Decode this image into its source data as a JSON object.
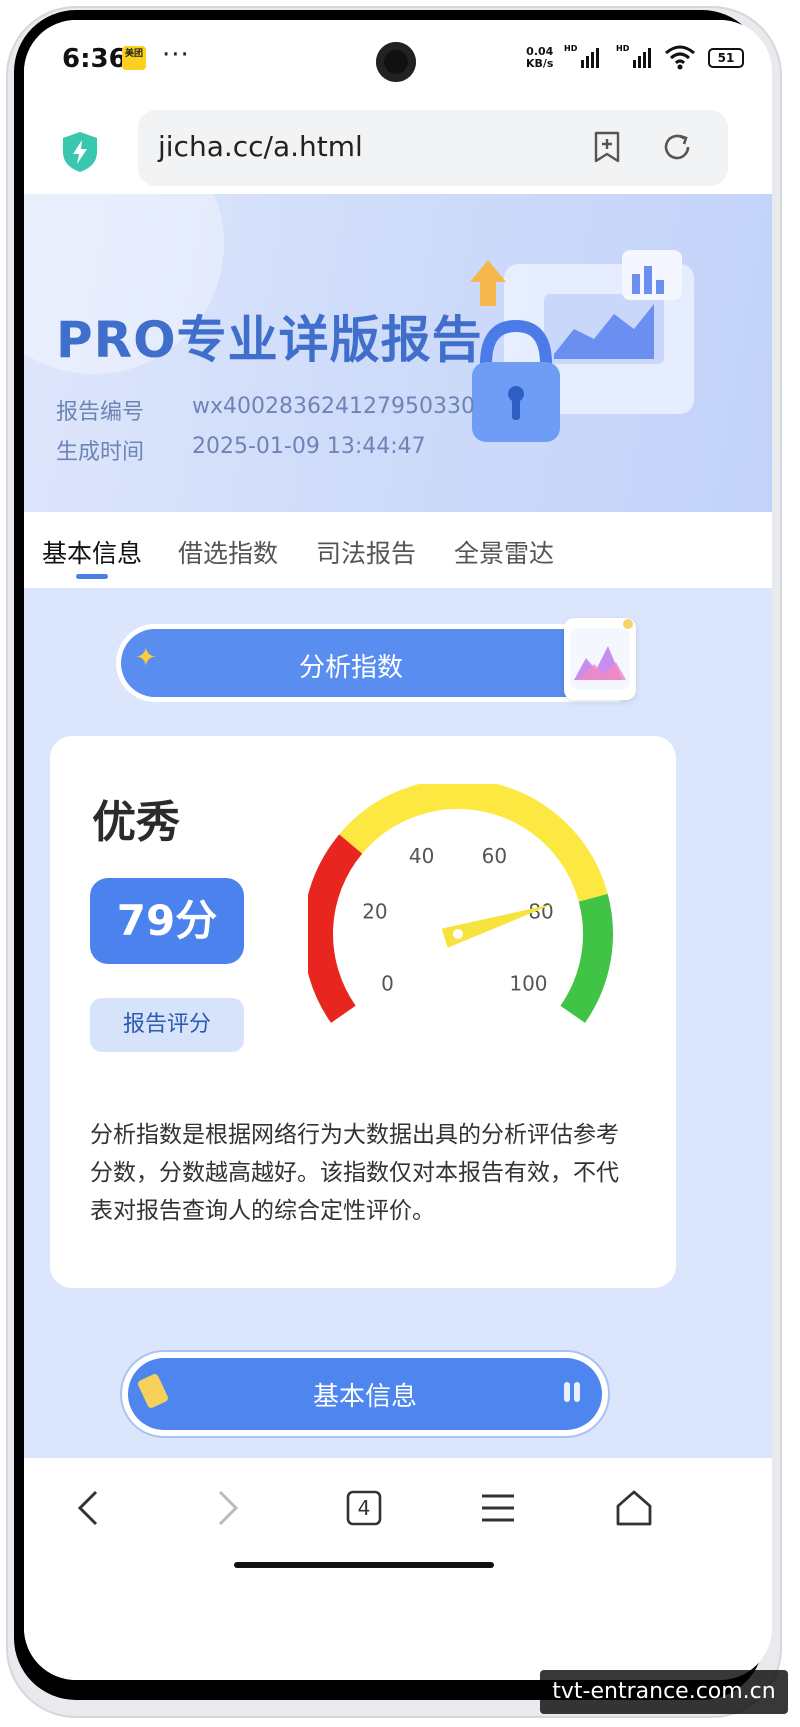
{
  "status_bar": {
    "time": "6:36",
    "app_badge": "美团",
    "more": "···",
    "net_speed_value": "0.04",
    "net_speed_unit": "KB/s",
    "hd_label_1": "HD",
    "hd_label_2": "HD",
    "battery": "51"
  },
  "browser": {
    "url": "jicha.cc/a.html"
  },
  "report": {
    "title": "PRO专业详版报告",
    "number_label": "报告编号",
    "number_value": "wx400283624127950330",
    "time_label": "生成时间",
    "time_value": "2025-01-09 13:44:47"
  },
  "tabs": [
    {
      "label": "基本信息",
      "active": true
    },
    {
      "label": "借选指数",
      "active": false
    },
    {
      "label": "司法报告",
      "active": false
    },
    {
      "label": "全景雷达",
      "active": false
    }
  ],
  "analysis": {
    "section_title": "分析指数",
    "grade": "优秀",
    "score": "79分",
    "score_label": "报告评分",
    "gauge": {
      "value": 79,
      "min": 0,
      "max": 100,
      "ticks": [
        "0",
        "20",
        "40",
        "60",
        "80",
        "100"
      ],
      "colors": {
        "low": "#e8261f",
        "mid": "#fde842",
        "high": "#41c446",
        "needle": "#f7e33d"
      }
    },
    "description": "分析指数是根据网络行为大数据出具的分析评估参考分数，分数越高越好。该指数仅对本报告有效，不代表对报告查询人的综合定性评价。"
  },
  "next_section": {
    "label": "基本信息"
  },
  "bottom_nav": {
    "tab_count": "4"
  },
  "watermark": "tvt-entrance.com.cn",
  "colors": {
    "accent": "#4b82ee",
    "title": "#3f6fcb",
    "content_bg": "#dbe6fd"
  }
}
